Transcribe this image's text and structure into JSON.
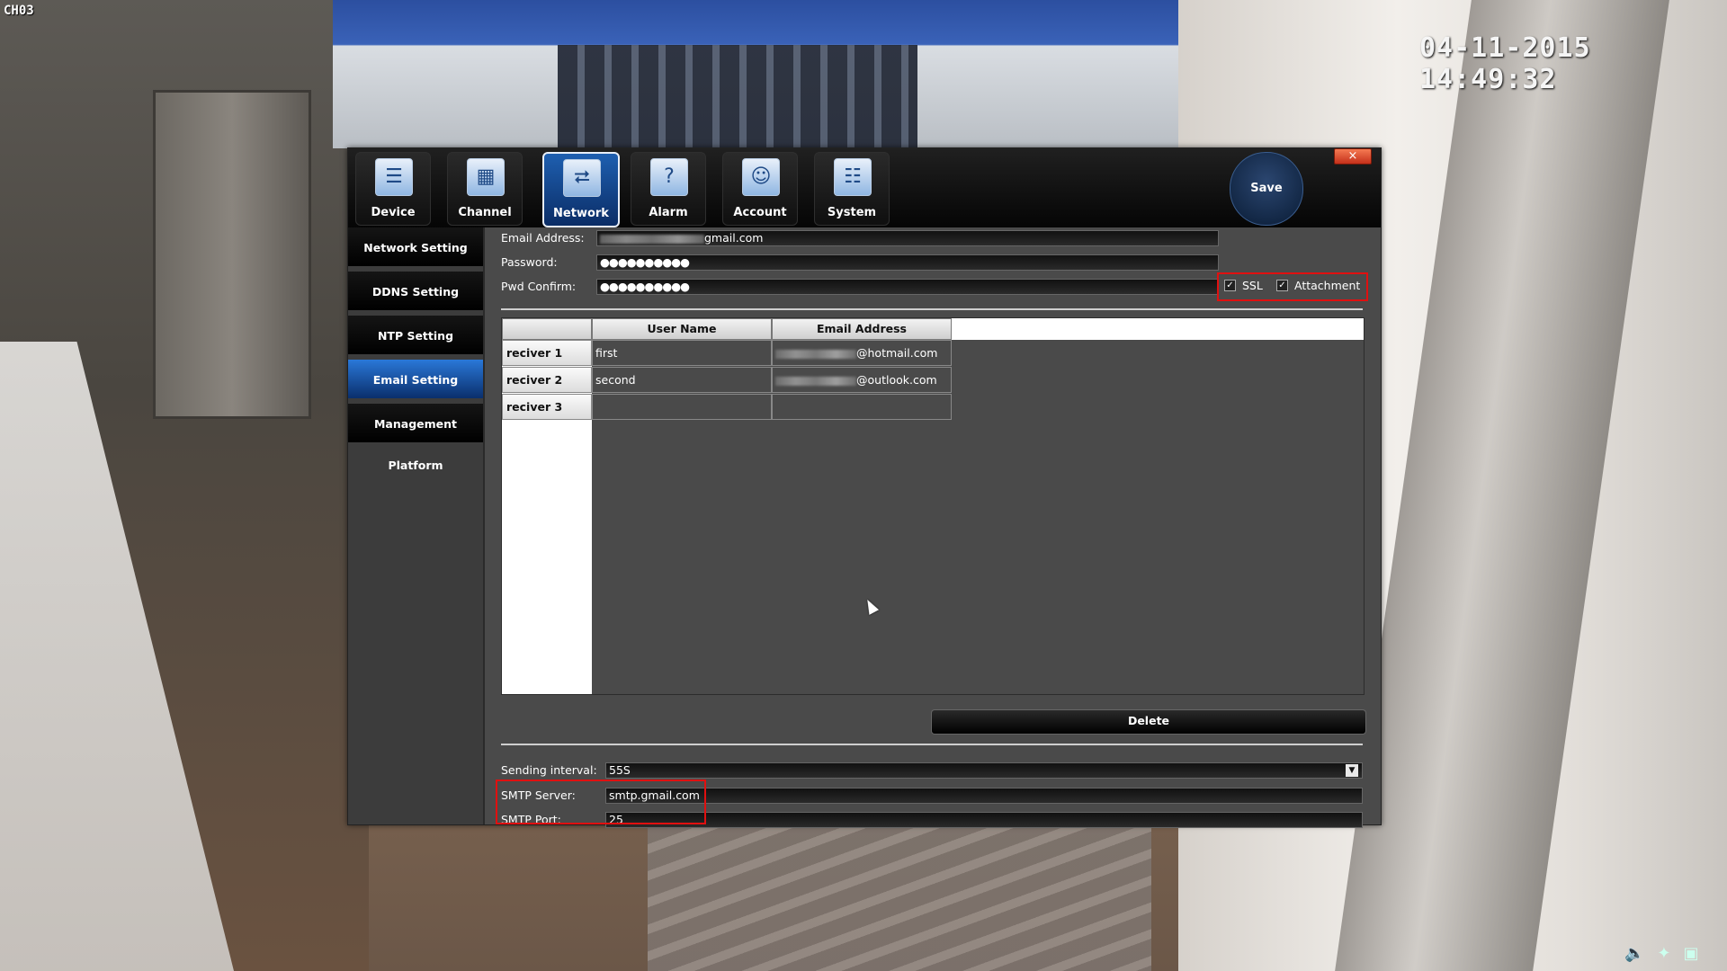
{
  "camera": {
    "channel": "CH03",
    "datetime": "04-11-2015 14:49:32"
  },
  "dialog": {
    "close_label": "×",
    "tabs": [
      {
        "label": "Device",
        "icon": "device-icon",
        "glyph": "☰"
      },
      {
        "label": "Channel",
        "icon": "channel-icon",
        "glyph": "▦"
      },
      {
        "label": "Network",
        "icon": "network-icon",
        "glyph": "⮂",
        "active": true
      },
      {
        "label": "Alarm",
        "icon": "alarm-icon",
        "glyph": "?"
      },
      {
        "label": "Account",
        "icon": "account-icon",
        "glyph": "☺"
      },
      {
        "label": "System",
        "icon": "system-icon",
        "glyph": "☷"
      }
    ],
    "save_label": "Save"
  },
  "sidebar": {
    "items": [
      {
        "label": "Network Setting"
      },
      {
        "label": "DDNS Setting"
      },
      {
        "label": "NTP Setting"
      },
      {
        "label": "Email Setting",
        "active": true
      },
      {
        "label": "Management Platform"
      }
    ]
  },
  "email": {
    "address_label": "Email Address:",
    "address_suffix": "gmail.com",
    "password_label": "Password:",
    "password_value": "●●●●●●●●●●",
    "confirm_label": "Pwd Confirm:",
    "confirm_value": "●●●●●●●●●●",
    "ssl_label": "SSL",
    "ssl_checked": true,
    "attachment_label": "Attachment",
    "attachment_checked": true
  },
  "receivers": {
    "columns": [
      "User Name",
      "Email Address"
    ],
    "rows": [
      {
        "label": "reciver 1",
        "user": "first",
        "email_suffix": "@hotmail.com"
      },
      {
        "label": "reciver 2",
        "user": "second",
        "email_suffix": "@outlook.com"
      },
      {
        "label": "reciver 3",
        "user": "",
        "email_suffix": ""
      }
    ],
    "delete_label": "Delete"
  },
  "smtp": {
    "interval_label": "Sending interval:",
    "interval_value": "55S",
    "server_label": "SMTP Server:",
    "server_value": "smtp.gmail.com",
    "port_label": "SMTP Port:",
    "port_value": "25"
  },
  "colors": {
    "accent_active": "#1e5fb0",
    "highlight_box": "#e01010"
  }
}
